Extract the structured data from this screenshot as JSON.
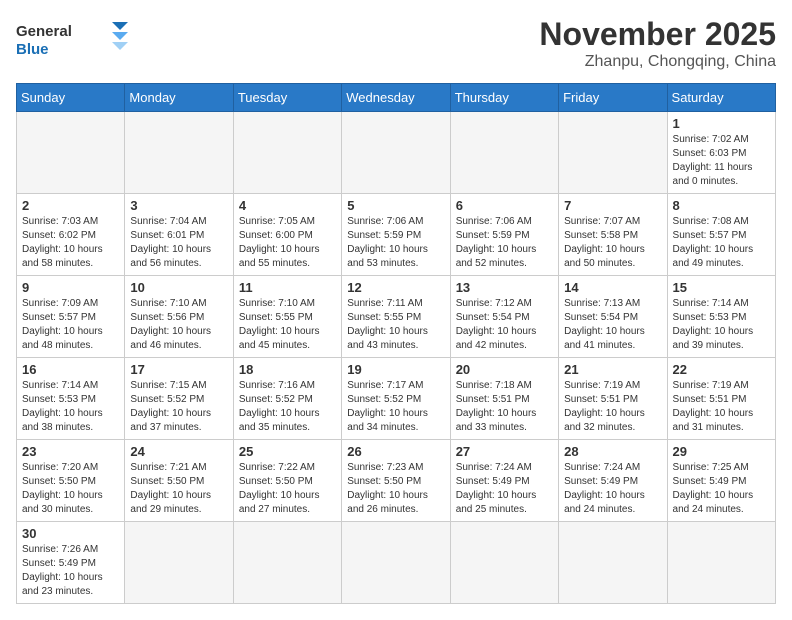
{
  "header": {
    "logo_general": "General",
    "logo_blue": "Blue",
    "month_title": "November 2025",
    "location": "Zhanpu, Chongqing, China"
  },
  "days_of_week": [
    "Sunday",
    "Monday",
    "Tuesday",
    "Wednesday",
    "Thursday",
    "Friday",
    "Saturday"
  ],
  "weeks": [
    [
      {
        "day": "",
        "info": ""
      },
      {
        "day": "",
        "info": ""
      },
      {
        "day": "",
        "info": ""
      },
      {
        "day": "",
        "info": ""
      },
      {
        "day": "",
        "info": ""
      },
      {
        "day": "",
        "info": ""
      },
      {
        "day": "1",
        "info": "Sunrise: 7:02 AM\nSunset: 6:03 PM\nDaylight: 11 hours\nand 0 minutes."
      }
    ],
    [
      {
        "day": "2",
        "info": "Sunrise: 7:03 AM\nSunset: 6:02 PM\nDaylight: 10 hours\nand 58 minutes."
      },
      {
        "day": "3",
        "info": "Sunrise: 7:04 AM\nSunset: 6:01 PM\nDaylight: 10 hours\nand 56 minutes."
      },
      {
        "day": "4",
        "info": "Sunrise: 7:05 AM\nSunset: 6:00 PM\nDaylight: 10 hours\nand 55 minutes."
      },
      {
        "day": "5",
        "info": "Sunrise: 7:06 AM\nSunset: 5:59 PM\nDaylight: 10 hours\nand 53 minutes."
      },
      {
        "day": "6",
        "info": "Sunrise: 7:06 AM\nSunset: 5:59 PM\nDaylight: 10 hours\nand 52 minutes."
      },
      {
        "day": "7",
        "info": "Sunrise: 7:07 AM\nSunset: 5:58 PM\nDaylight: 10 hours\nand 50 minutes."
      },
      {
        "day": "8",
        "info": "Sunrise: 7:08 AM\nSunset: 5:57 PM\nDaylight: 10 hours\nand 49 minutes."
      }
    ],
    [
      {
        "day": "9",
        "info": "Sunrise: 7:09 AM\nSunset: 5:57 PM\nDaylight: 10 hours\nand 48 minutes."
      },
      {
        "day": "10",
        "info": "Sunrise: 7:10 AM\nSunset: 5:56 PM\nDaylight: 10 hours\nand 46 minutes."
      },
      {
        "day": "11",
        "info": "Sunrise: 7:10 AM\nSunset: 5:55 PM\nDaylight: 10 hours\nand 45 minutes."
      },
      {
        "day": "12",
        "info": "Sunrise: 7:11 AM\nSunset: 5:55 PM\nDaylight: 10 hours\nand 43 minutes."
      },
      {
        "day": "13",
        "info": "Sunrise: 7:12 AM\nSunset: 5:54 PM\nDaylight: 10 hours\nand 42 minutes."
      },
      {
        "day": "14",
        "info": "Sunrise: 7:13 AM\nSunset: 5:54 PM\nDaylight: 10 hours\nand 41 minutes."
      },
      {
        "day": "15",
        "info": "Sunrise: 7:14 AM\nSunset: 5:53 PM\nDaylight: 10 hours\nand 39 minutes."
      }
    ],
    [
      {
        "day": "16",
        "info": "Sunrise: 7:14 AM\nSunset: 5:53 PM\nDaylight: 10 hours\nand 38 minutes."
      },
      {
        "day": "17",
        "info": "Sunrise: 7:15 AM\nSunset: 5:52 PM\nDaylight: 10 hours\nand 37 minutes."
      },
      {
        "day": "18",
        "info": "Sunrise: 7:16 AM\nSunset: 5:52 PM\nDaylight: 10 hours\nand 35 minutes."
      },
      {
        "day": "19",
        "info": "Sunrise: 7:17 AM\nSunset: 5:52 PM\nDaylight: 10 hours\nand 34 minutes."
      },
      {
        "day": "20",
        "info": "Sunrise: 7:18 AM\nSunset: 5:51 PM\nDaylight: 10 hours\nand 33 minutes."
      },
      {
        "day": "21",
        "info": "Sunrise: 7:19 AM\nSunset: 5:51 PM\nDaylight: 10 hours\nand 32 minutes."
      },
      {
        "day": "22",
        "info": "Sunrise: 7:19 AM\nSunset: 5:51 PM\nDaylight: 10 hours\nand 31 minutes."
      }
    ],
    [
      {
        "day": "23",
        "info": "Sunrise: 7:20 AM\nSunset: 5:50 PM\nDaylight: 10 hours\nand 30 minutes."
      },
      {
        "day": "24",
        "info": "Sunrise: 7:21 AM\nSunset: 5:50 PM\nDaylight: 10 hours\nand 29 minutes."
      },
      {
        "day": "25",
        "info": "Sunrise: 7:22 AM\nSunset: 5:50 PM\nDaylight: 10 hours\nand 27 minutes."
      },
      {
        "day": "26",
        "info": "Sunrise: 7:23 AM\nSunset: 5:50 PM\nDaylight: 10 hours\nand 26 minutes."
      },
      {
        "day": "27",
        "info": "Sunrise: 7:24 AM\nSunset: 5:49 PM\nDaylight: 10 hours\nand 25 minutes."
      },
      {
        "day": "28",
        "info": "Sunrise: 7:24 AM\nSunset: 5:49 PM\nDaylight: 10 hours\nand 24 minutes."
      },
      {
        "day": "29",
        "info": "Sunrise: 7:25 AM\nSunset: 5:49 PM\nDaylight: 10 hours\nand 24 minutes."
      }
    ],
    [
      {
        "day": "30",
        "info": "Sunrise: 7:26 AM\nSunset: 5:49 PM\nDaylight: 10 hours\nand 23 minutes."
      },
      {
        "day": "",
        "info": ""
      },
      {
        "day": "",
        "info": ""
      },
      {
        "day": "",
        "info": ""
      },
      {
        "day": "",
        "info": ""
      },
      {
        "day": "",
        "info": ""
      },
      {
        "day": "",
        "info": ""
      }
    ]
  ]
}
